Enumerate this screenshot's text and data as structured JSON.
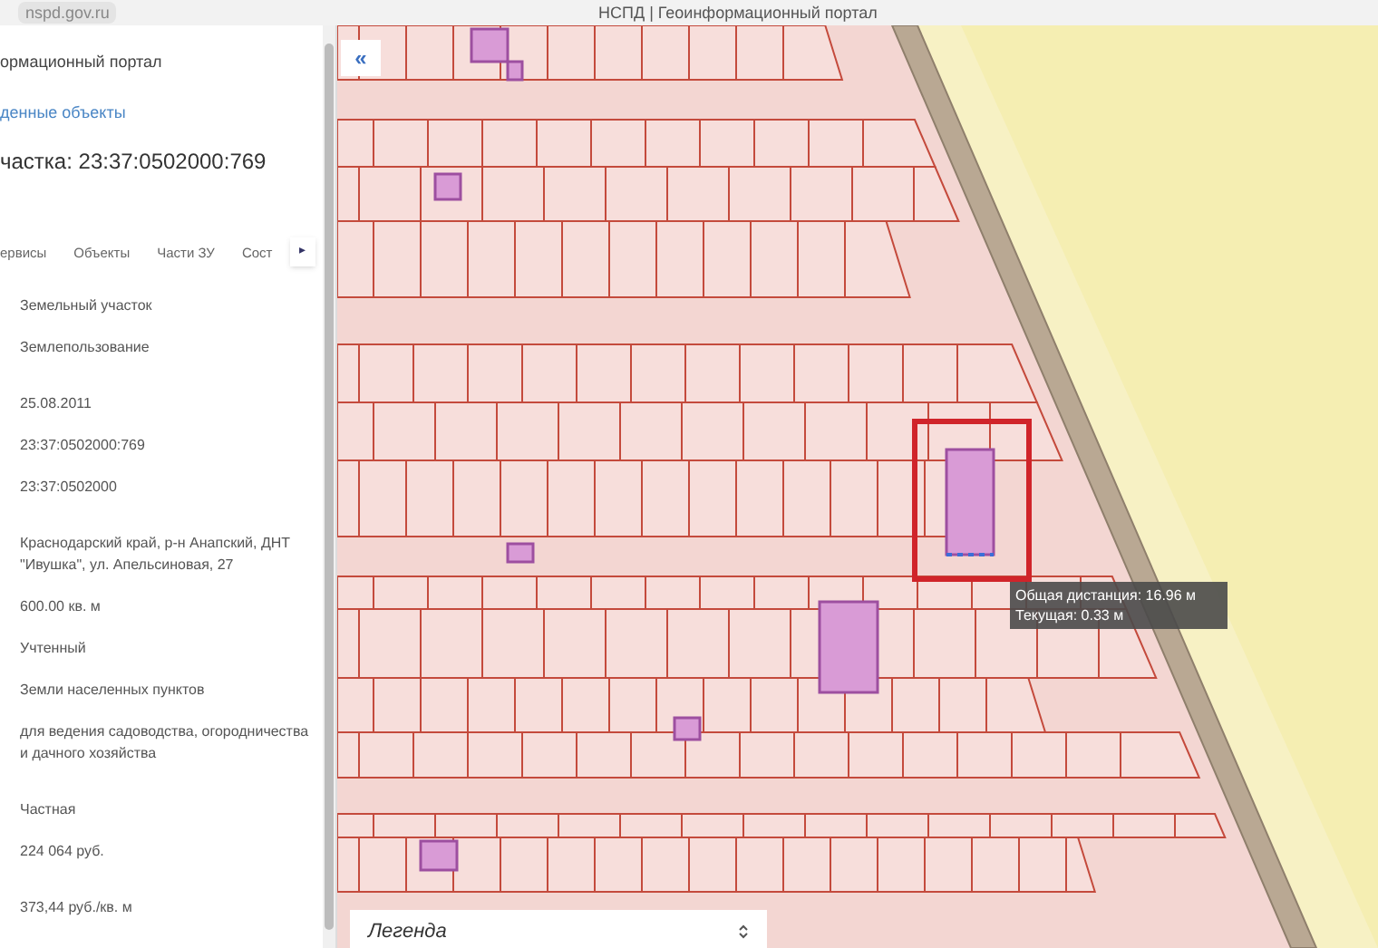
{
  "browser": {
    "address": "nspd.gov.ru",
    "title": "НСПД | Геоинформационный портал"
  },
  "panel": {
    "portal_title": "ормационный портал",
    "link": "денные объекты",
    "heading": "частка: 23:37:0502000:769",
    "tabs": [
      {
        "label": "ервисы",
        "selected": false
      },
      {
        "label": "Объекты",
        "selected": false
      },
      {
        "label": "Части ЗУ",
        "selected": false
      },
      {
        "label": "Сост",
        "selected": false
      }
    ],
    "tabs_scroll": "▸",
    "values": [
      "Земельный участок",
      "Землепользование",
      "25.08.2011",
      "23:37:0502000:769",
      "23:37:0502000",
      "Краснодарский край, р-н Анапский, ДНТ \"Ивушка\", ул. Апельсиновая, 27",
      "600.00 кв. м",
      "Учтенный",
      "Земли населенных пунктов",
      "для ведения садоводства, огородничества и дачного хозяйства",
      "Частная",
      "224 064 руб.",
      "373,44 руб./кв. м"
    ]
  },
  "map": {
    "collapse_button": "«",
    "tooltip": {
      "total": "Общая дистанция: 16.96 м",
      "current": "Текущая: 0.33 м"
    },
    "legend": {
      "label": "Легенда"
    }
  }
}
